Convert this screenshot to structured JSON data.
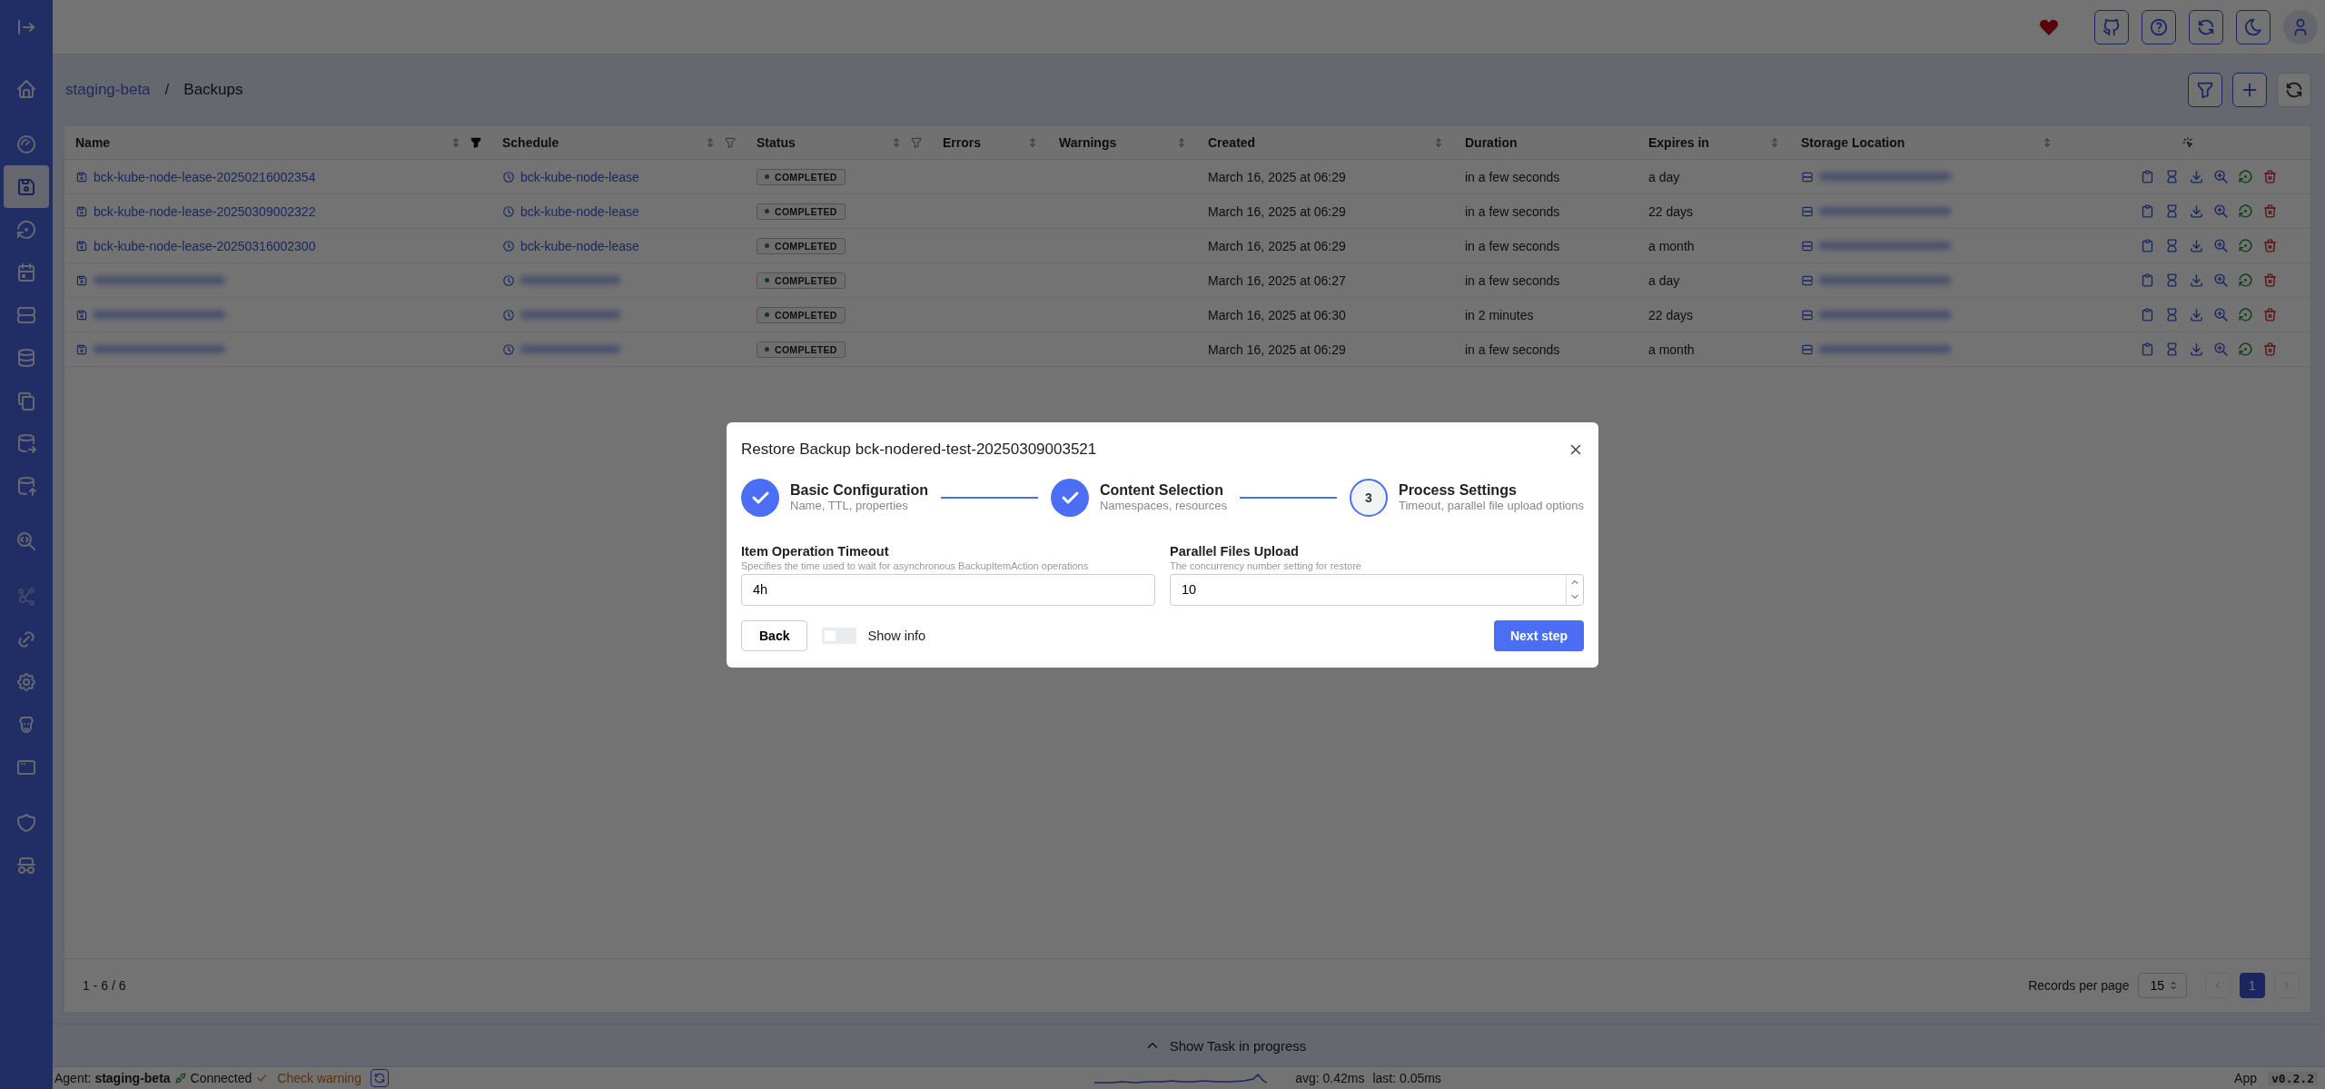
{
  "sidebar": {
    "groups": [
      [
        {
          "kind": "collapse",
          "selected": false,
          "disabled": false
        }
      ],
      [
        {
          "kind": "home",
          "selected": false,
          "disabled": false
        }
      ],
      [
        {
          "kind": "gauge",
          "selected": false,
          "disabled": false
        },
        {
          "kind": "floppy",
          "selected": true,
          "disabled": false
        },
        {
          "kind": "restore",
          "selected": false,
          "disabled": false
        },
        {
          "kind": "calendar",
          "selected": false,
          "disabled": false
        },
        {
          "kind": "server",
          "selected": false,
          "disabled": false
        },
        {
          "kind": "database",
          "selected": false,
          "disabled": false
        },
        {
          "kind": "copies",
          "selected": false,
          "disabled": false
        },
        {
          "kind": "dbexport",
          "selected": false,
          "disabled": false
        },
        {
          "kind": "dbimport",
          "selected": false,
          "disabled": false
        }
      ],
      [
        {
          "kind": "searchcode",
          "selected": false,
          "disabled": false
        }
      ],
      [
        {
          "kind": "graph",
          "selected": false,
          "disabled": true
        },
        {
          "kind": "link",
          "selected": false,
          "disabled": false
        },
        {
          "kind": "gear",
          "selected": false,
          "disabled": false
        },
        {
          "kind": "dog",
          "selected": false,
          "disabled": false
        },
        {
          "kind": "window",
          "selected": false,
          "disabled": false
        }
      ],
      [
        {
          "kind": "shield",
          "selected": false,
          "disabled": false
        },
        {
          "kind": "spy",
          "selected": false,
          "disabled": false
        }
      ]
    ]
  },
  "breadcrumb": {
    "items": [
      {
        "label": "staging-beta",
        "kind": "link"
      },
      {
        "label": "Backups",
        "kind": "current"
      }
    ],
    "separator": "/"
  },
  "table": {
    "columns": [
      {
        "label": "Name",
        "sortable": true,
        "filterable": true,
        "filtered": true
      },
      {
        "label": "Schedule",
        "sortable": true,
        "filterable": true,
        "filtered": false
      },
      {
        "label": "Status",
        "sortable": true,
        "filterable": true,
        "filtered": false
      },
      {
        "label": "Errors",
        "sortable": true,
        "filterable": false
      },
      {
        "label": "Warnings",
        "sortable": true,
        "filterable": false
      },
      {
        "label": "Created",
        "sortable": true,
        "filterable": false
      },
      {
        "label": "Duration",
        "sortable": false,
        "filterable": false
      },
      {
        "label": "Expires in",
        "sortable": true,
        "filterable": false
      },
      {
        "label": "Storage Location",
        "sortable": true,
        "filterable": false
      }
    ],
    "rows": [
      {
        "name": "bck-kube-node-lease-20250216002354",
        "schedule": "bck-kube-node-lease",
        "status": "COMPLETED",
        "created": "March 16, 2025 at 06:29",
        "duration": "in a few seconds",
        "expires_in": "a day",
        "name_blurred": false,
        "schedule_blurred": false,
        "storage_blurred": true
      },
      {
        "name": "bck-kube-node-lease-20250309002322",
        "schedule": "bck-kube-node-lease",
        "status": "COMPLETED",
        "created": "March 16, 2025 at 06:29",
        "duration": "in a few seconds",
        "expires_in": "22 days",
        "name_blurred": false,
        "schedule_blurred": false,
        "storage_blurred": true
      },
      {
        "name": "bck-kube-node-lease-20250316002300",
        "schedule": "bck-kube-node-lease",
        "status": "COMPLETED",
        "created": "March 16, 2025 at 06:29",
        "duration": "in a few seconds",
        "expires_in": "a month",
        "name_blurred": false,
        "schedule_blurred": false,
        "storage_blurred": true
      },
      {
        "status": "COMPLETED",
        "created": "March 16, 2025 at 06:27",
        "duration": "in a few seconds",
        "expires_in": "a day",
        "name_blurred": true,
        "schedule_blurred": true,
        "storage_blurred": true
      },
      {
        "status": "COMPLETED",
        "created": "March 16, 2025 at 06:30",
        "duration": "in 2 minutes",
        "expires_in": "22 days",
        "name_blurred": true,
        "schedule_blurred": true,
        "storage_blurred": true
      },
      {
        "status": "COMPLETED",
        "created": "March 16, 2025 at 06:29",
        "duration": "in a few seconds",
        "expires_in": "a month",
        "name_blurred": true,
        "schedule_blurred": true,
        "storage_blurred": true
      }
    ],
    "footer": {
      "range": "1 - 6 / 6",
      "records_label": "Records per page",
      "page_size": "15",
      "pages": [
        {
          "label": "1",
          "selected": true
        }
      ]
    }
  },
  "task_bar": {
    "label": "Show Task in progress",
    "expanded": false
  },
  "status_bar": {
    "agent": "Agent: **staging-beta**",
    "connection": "Connected",
    "check": "Check warning",
    "avg": "avg: 0.42ms",
    "last": "last: 0.05ms",
    "app": "App",
    "version": "v0.2.2"
  },
  "modal": {
    "title": "Restore Backup bck-nodered-test-20250309003521",
    "steps": [
      {
        "title": "Basic Configuration",
        "subtitle": "Name, TTL, properties",
        "completed": true
      },
      {
        "title": "Content Selection",
        "subtitle": "Namespaces, resources",
        "completed": true
      },
      {
        "title": "Process Settings",
        "subtitle": "Timeout, parallel file upload options",
        "completed": false,
        "number": "3"
      }
    ],
    "fields": [
      {
        "label": "Item Operation Timeout",
        "hint": "Specifies the time used to wait for asynchronous BackupItemAction operations",
        "value": "4h",
        "kind": "text"
      },
      {
        "label": "Parallel Files Upload",
        "hint": "The concurrency number setting for restore",
        "value": "10",
        "kind": "number"
      }
    ],
    "back": "Back",
    "toggle": {
      "label": "Show info",
      "on": false
    },
    "next": "Next step"
  }
}
